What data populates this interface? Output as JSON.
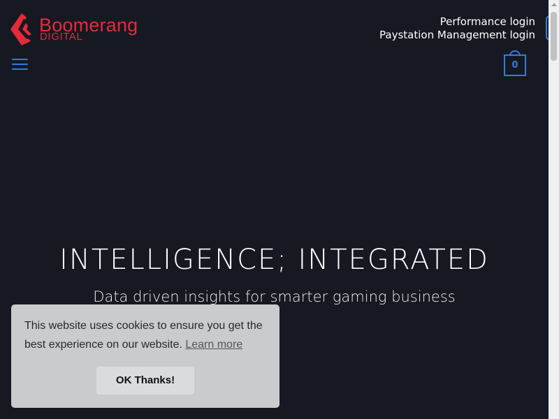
{
  "brand": {
    "name": "Boomerang",
    "sub": "DIGITAL",
    "color": "#e52a3a"
  },
  "header": {
    "links": [
      "Performance login",
      "Paystation Management login"
    ],
    "menu_icon": "hamburger-menu-icon",
    "cart": {
      "icon": "shopping-bag-icon",
      "count": "0"
    },
    "accent_color": "#2f7de1"
  },
  "hero": {
    "title": "INTELLIGENCE; INTEGRATED",
    "subtitle": "Data driven insights for smarter gaming business"
  },
  "cookie_banner": {
    "message": "This website uses cookies to ensure you get the best experience on our website.",
    "link_label": "Learn more",
    "button_label": "OK Thanks!"
  },
  "colors": {
    "background": "#161922",
    "banner": "#cacbcd"
  }
}
